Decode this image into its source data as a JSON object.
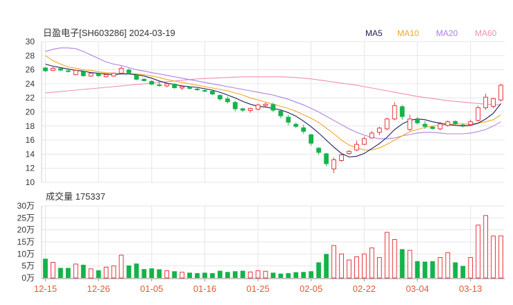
{
  "chart_title": "日盈电子[SH603286] 2024-03-19",
  "legend": [
    {
      "label": "MA5",
      "color": "#1c1c5c"
    },
    {
      "label": "MA10",
      "color": "#f5a623"
    },
    {
      "label": "MA20",
      "color": "#b07fe0"
    },
    {
      "label": "MA60",
      "color": "#ef8fb5"
    }
  ],
  "colors": {
    "up": "#e8323a",
    "down": "#14b34a",
    "grid": "#e6e6e6",
    "axis_text": "#333333",
    "date_text": "#e05a2b"
  },
  "chart_data": {
    "type": "candlestick",
    "dates": [
      "12-15",
      "12-18",
      "12-19",
      "12-20",
      "12-21",
      "12-22",
      "12-25",
      "12-26",
      "12-27",
      "12-28",
      "12-29",
      "01-02",
      "01-03",
      "01-04",
      "01-05",
      "01-08",
      "01-09",
      "01-10",
      "01-11",
      "01-12",
      "01-15",
      "01-16",
      "01-17",
      "01-18",
      "01-19",
      "01-22",
      "01-23",
      "01-24",
      "01-25",
      "01-26",
      "01-29",
      "01-30",
      "01-31",
      "02-01",
      "02-02",
      "02-05",
      "02-06",
      "02-07",
      "02-08",
      "02-19",
      "02-20",
      "02-21",
      "02-22",
      "02-23",
      "02-26",
      "02-27",
      "02-28",
      "02-29",
      "03-01",
      "03-04",
      "03-05",
      "03-06",
      "03-07",
      "03-08",
      "03-11",
      "03-12",
      "03-13",
      "03-14",
      "03-15",
      "03-18",
      "03-19"
    ],
    "x_tick_labels": [
      "12-15",
      "12-26",
      "01-05",
      "01-16",
      "01-25",
      "02-05",
      "02-22",
      "03-04",
      "03-13"
    ],
    "price_axis": {
      "min": 10,
      "max": 30,
      "ticks": [
        10,
        12,
        14,
        16,
        18,
        20,
        22,
        24,
        26,
        28,
        30
      ]
    },
    "ohlc": [
      [
        26.3,
        26.4,
        25.7,
        25.8
      ],
      [
        25.9,
        26.4,
        25.8,
        26.2
      ],
      [
        26.2,
        26.3,
        25.8,
        25.9
      ],
      [
        25.9,
        26.1,
        25.6,
        25.7
      ],
      [
        25.3,
        26.0,
        25.2,
        25.9
      ],
      [
        25.8,
        25.9,
        25.0,
        25.1
      ],
      [
        25.1,
        25.6,
        25.0,
        25.5
      ],
      [
        25.5,
        25.6,
        25.0,
        25.1
      ],
      [
        25.0,
        25.4,
        24.9,
        25.3
      ],
      [
        25.1,
        25.6,
        25.0,
        25.5
      ],
      [
        25.5,
        26.5,
        25.4,
        26.2
      ],
      [
        26.0,
        26.2,
        25.4,
        25.5
      ],
      [
        25.3,
        25.4,
        24.5,
        24.6
      ],
      [
        24.7,
        24.8,
        24.3,
        24.4
      ],
      [
        24.4,
        24.5,
        23.8,
        23.9
      ],
      [
        23.9,
        24.4,
        23.6,
        23.7
      ],
      [
        23.7,
        24.1,
        23.5,
        24.0
      ],
      [
        24.0,
        24.1,
        23.3,
        23.4
      ],
      [
        23.4,
        23.7,
        23.1,
        23.6
      ],
      [
        23.6,
        23.6,
        23.2,
        23.3
      ],
      [
        23.3,
        23.5,
        23.0,
        23.1
      ],
      [
        23.1,
        23.2,
        22.8,
        22.9
      ],
      [
        23.0,
        23.1,
        22.4,
        22.5
      ],
      [
        22.4,
        22.5,
        21.6,
        21.8
      ],
      [
        21.9,
        22.2,
        21.2,
        21.4
      ],
      [
        21.4,
        21.6,
        20.1,
        20.4
      ],
      [
        20.5,
        20.6,
        20.0,
        20.2
      ],
      [
        20.2,
        20.6,
        19.9,
        20.5
      ],
      [
        20.4,
        21.2,
        20.2,
        21.0
      ],
      [
        20.9,
        21.3,
        20.7,
        21.1
      ],
      [
        21.1,
        21.3,
        20.0,
        20.2
      ],
      [
        20.2,
        20.3,
        19.1,
        19.4
      ],
      [
        19.3,
        19.6,
        18.1,
        18.5
      ],
      [
        18.3,
        18.5,
        17.7,
        17.9
      ],
      [
        17.8,
        18.2,
        16.9,
        17.2
      ],
      [
        16.8,
        16.9,
        15.2,
        15.5
      ],
      [
        14.9,
        15.0,
        13.9,
        14.2
      ],
      [
        14.1,
        14.2,
        12.3,
        12.6
      ],
      [
        11.9,
        13.5,
        11.3,
        13.2
      ],
      [
        13.1,
        14.1,
        12.9,
        13.9
      ],
      [
        14.1,
        14.6,
        13.9,
        14.4
      ],
      [
        14.6,
        15.9,
        14.4,
        15.4
      ],
      [
        15.4,
        16.5,
        15.3,
        16.2
      ],
      [
        16.3,
        17.3,
        16.2,
        17.0
      ],
      [
        17.1,
        17.9,
        16.7,
        17.7
      ],
      [
        17.6,
        19.2,
        17.4,
        19.0
      ],
      [
        19.0,
        21.4,
        18.8,
        20.9
      ],
      [
        20.8,
        21.0,
        18.9,
        19.3
      ],
      [
        17.5,
        19.6,
        17.3,
        19.0
      ],
      [
        18.9,
        19.3,
        18.2,
        18.4
      ],
      [
        18.3,
        18.7,
        17.6,
        17.9
      ],
      [
        17.9,
        18.0,
        17.5,
        17.6
      ],
      [
        17.6,
        18.6,
        17.4,
        18.3
      ],
      [
        18.1,
        18.8,
        17.9,
        18.6
      ],
      [
        18.7,
        18.8,
        18.1,
        18.3
      ],
      [
        18.2,
        18.4,
        17.8,
        18.1
      ],
      [
        18.2,
        18.9,
        18.0,
        18.6
      ],
      [
        18.8,
        20.9,
        18.6,
        20.6
      ],
      [
        20.6,
        22.6,
        20.3,
        22.1
      ],
      [
        20.8,
        22.0,
        20.5,
        21.9
      ],
      [
        21.7,
        24.0,
        21.5,
        23.8
      ]
    ],
    "ma": {
      "MA5": [
        26.8,
        26.5,
        26.3,
        26.1,
        25.9,
        25.8,
        25.6,
        25.5,
        25.4,
        25.3,
        25.4,
        25.4,
        25.3,
        25.1,
        24.8,
        24.4,
        24.1,
        23.9,
        23.7,
        23.6,
        23.5,
        23.3,
        23.1,
        22.8,
        22.4,
        22.0,
        21.5,
        21.1,
        20.8,
        20.7,
        20.5,
        20.3,
        19.9,
        19.4,
        18.7,
        17.9,
        17.0,
        16.0,
        15.0,
        14.1,
        13.6,
        13.7,
        14.1,
        14.8,
        15.5,
        16.4,
        17.5,
        18.3,
        18.8,
        19.0,
        18.9,
        18.6,
        18.4,
        18.2,
        18.1,
        18.0,
        18.1,
        18.4,
        19.0,
        19.8,
        21.2
      ],
      "MA10": [
        28.0,
        27.3,
        26.8,
        26.4,
        26.2,
        26.0,
        25.9,
        25.7,
        25.6,
        25.5,
        25.5,
        25.4,
        25.4,
        25.3,
        25.1,
        24.9,
        24.6,
        24.4,
        24.2,
        24.0,
        23.8,
        23.6,
        23.4,
        23.2,
        23.0,
        22.7,
        22.4,
        22.0,
        21.7,
        21.4,
        21.1,
        20.8,
        20.5,
        20.1,
        19.6,
        19.1,
        18.5,
        17.7,
        16.9,
        16.0,
        15.3,
        14.9,
        14.6,
        14.6,
        14.9,
        15.4,
        16.0,
        16.6,
        17.2,
        17.5,
        17.8,
        18.0,
        18.1,
        18.2,
        18.3,
        18.3,
        18.3,
        18.4,
        18.6,
        18.9,
        19.6
      ],
      "MA20": [
        28.6,
        28.9,
        29.1,
        29.1,
        29.0,
        28.6,
        28.1,
        27.6,
        27.1,
        26.8,
        26.6,
        26.3,
        26.0,
        25.8,
        25.6,
        25.4,
        25.2,
        25.0,
        24.8,
        24.6,
        24.4,
        24.2,
        24.0,
        23.8,
        23.6,
        23.4,
        23.2,
        23.0,
        22.8,
        22.6,
        22.4,
        22.1,
        21.8,
        21.4,
        21.0,
        20.5,
        20.0,
        19.4,
        18.8,
        18.2,
        17.6,
        17.1,
        16.7,
        16.4,
        16.2,
        16.2,
        16.3,
        16.6,
        16.8,
        17.0,
        17.1,
        17.1,
        17.0,
        16.9,
        16.9,
        16.9,
        17.0,
        17.2,
        17.5,
        18.0,
        18.6
      ],
      "MA60": [
        22.7,
        22.8,
        22.9,
        23.0,
        23.1,
        23.2,
        23.3,
        23.4,
        23.5,
        23.6,
        23.7,
        23.8,
        23.9,
        24.0,
        24.1,
        24.2,
        24.3,
        24.4,
        24.5,
        24.6,
        24.7,
        24.75,
        24.8,
        24.85,
        24.9,
        24.95,
        25.0,
        25.0,
        25.0,
        25.0,
        25.0,
        25.0,
        24.95,
        24.9,
        24.8,
        24.7,
        24.55,
        24.4,
        24.25,
        24.1,
        23.95,
        23.8,
        23.6,
        23.4,
        23.2,
        23.0,
        22.8,
        22.6,
        22.4,
        22.2,
        22.05,
        21.9,
        21.75,
        21.6,
        21.5,
        21.4,
        21.3,
        21.2,
        21.1,
        21.05,
        21.0
      ]
    },
    "volume_title": "成交量 175337",
    "volume_axis": {
      "max": 300000,
      "tick_values": [
        0,
        50000,
        100000,
        150000,
        200000,
        250000,
        300000
      ],
      "tick_labels": [
        "0万",
        "5万",
        "10万",
        "15万",
        "20万",
        "25万",
        "30万"
      ]
    },
    "volume": [
      80000,
      65000,
      42000,
      42000,
      58000,
      55000,
      38000,
      32000,
      45000,
      50000,
      95000,
      52000,
      60000,
      37000,
      40000,
      36000,
      30000,
      28000,
      24000,
      22000,
      20000,
      22000,
      20000,
      30000,
      25000,
      28000,
      30000,
      25000,
      30000,
      28000,
      22000,
      18000,
      20000,
      24000,
      25000,
      28000,
      65000,
      100000,
      135000,
      100000,
      75000,
      88000,
      100000,
      125000,
      85000,
      190000,
      160000,
      120000,
      115000,
      70000,
      68000,
      70000,
      85000,
      105000,
      65000,
      50000,
      85000,
      220000,
      260000,
      175000,
      175337
    ]
  }
}
